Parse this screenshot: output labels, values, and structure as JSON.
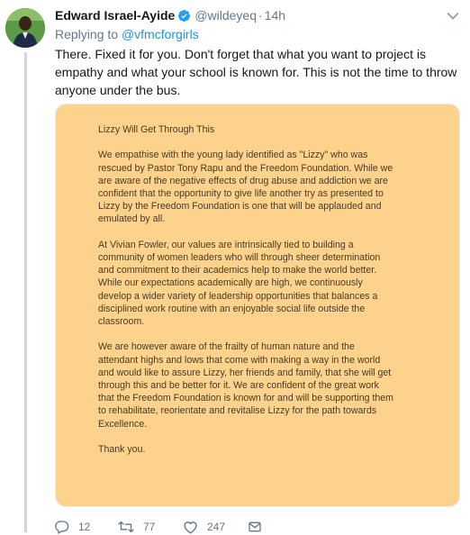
{
  "tweet": {
    "author_name": "Edward Israel-Ayide",
    "handle": "@wildeyeq",
    "separator": "·",
    "time": "14h",
    "replying_prefix": "Replying to",
    "replying_to": "@vfmcforgirls",
    "text": "There. Fixed it for you. Don't forget that what you want to project is empathy and what your school is known for. This is not the time to throw anyone under the bus."
  },
  "letter": {
    "title": "Lizzy Will Get Through This",
    "paragraphs": [
      "We empathise with the young lady identified as \"Lizzy\" who was rescued by Pastor Tony Rapu and the Freedom Foundation. While we are aware of the negative effects of drug abuse and addiction we are confident that the opportunity to give life another try as presented to Lizzy by the Freedom Foundation is one that will be applauded and emulated by all.",
      "At Vivian Fowler, our values are intrinsically tied to building a community of women leaders who will through sheer determination and commitment to their academics help to make the world better. While our expectations academically are high, we continuously develop a wider variety of leadership opportunities that balances a disciplined work routine with an enjoyable social life outside the classroom.",
      "We are however aware of the frailty of human nature and the attendant highs and lows that come with making a way in the world and would like to assure Lizzy, her friends and family, that she will get through this and be better for it. We are confident of the great work that the Freedom Foundation is known for and will be supporting them to rehabilitate, reorientate and revitalise Lizzy for the path towards Excellence.",
      "Thank you."
    ]
  },
  "actions": {
    "replies": "12",
    "retweets": "77",
    "likes": "247"
  },
  "colors": {
    "verified": "#1da1f2",
    "link": "#1b95e0",
    "muted": "#657786",
    "letter_bg": "#fcd28d",
    "retweet": "#657786"
  },
  "icons": [
    "verified-badge-icon",
    "chevron-down-icon",
    "reply-icon",
    "retweet-icon",
    "like-icon",
    "direct-message-icon"
  ]
}
